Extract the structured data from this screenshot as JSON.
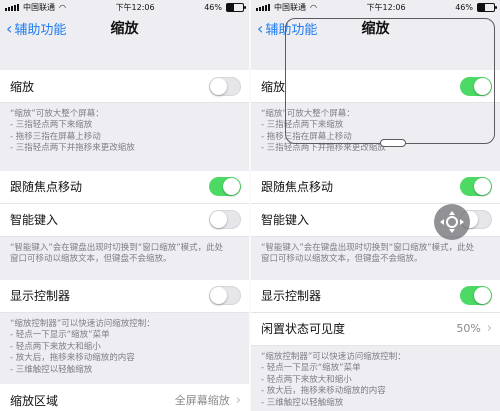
{
  "left": {
    "status": {
      "carrier": "中国联通",
      "time": "下午12:06",
      "battery": "46%",
      "battery_level": 0.46
    },
    "nav": {
      "back": "辅助功能",
      "title": "缩放"
    },
    "zoom_row": {
      "label": "缩放",
      "on": false
    },
    "zoom_note": [
      "“缩放”可放大整个屏幕：",
      "- 三指轻点两下来缩放",
      "- 拖移三指在屏幕上移动",
      "- 三指轻点两下并拖移来更改缩放"
    ],
    "follow_row": {
      "label": "跟随焦点移动",
      "on": true
    },
    "keyboard_row": {
      "label": "智能键入",
      "on": false
    },
    "keyboard_note": [
      "“智能键入”会在键盘出现时切换到“窗口缩放”模式，此处",
      "窗口可移动以缩放文本，但键盘不会缩放。"
    ],
    "controller_row": {
      "label": "显示控制器",
      "on": false
    },
    "controller_note": [
      "“缩放控制器”可以快速访问缩放控制：",
      "- 轻点一下显示“缩放”菜单",
      "- 轻点两下来放大和缩小",
      "- 放大后，拖移来移动缩放的内容",
      "- 三维触控以轻触缩放"
    ],
    "region_row": {
      "label": "缩放区域",
      "value": "全屏幕缩放"
    }
  },
  "right": {
    "status": {
      "carrier": "中国联通",
      "time": "下午12:06",
      "battery": "46%",
      "battery_level": 0.46
    },
    "nav": {
      "back": "辅助功能",
      "title": "缩放"
    },
    "zoom_row": {
      "label": "缩放",
      "on": true
    },
    "zoom_note": [
      "“缩放”可放大整个屏幕：",
      "- 三指轻点两下来缩放",
      "- 拖移三指在屏幕上移动",
      "- 三指轻点两下并拖移来更改缩放"
    ],
    "follow_row": {
      "label": "跟随焦点移动",
      "on": true
    },
    "keyboard_row": {
      "label": "智能键入",
      "on": false
    },
    "keyboard_note": [
      "“智能键入”会在键盘出现时切换到“窗口缩放”模式，此处",
      "窗口可移动以缩放文本，但键盘不会缩放。"
    ],
    "controller_row": {
      "label": "显示控制器",
      "on": true
    },
    "idle_row": {
      "label": "闲置状态可见度",
      "value": "50%"
    },
    "controller_note": [
      "“缩放控制器”可以快速访问缩放控制：",
      "- 轻点一下显示“缩放”菜单",
      "- 轻点两下来放大和缩小",
      "- 放大后，拖移来移动缩放的内容",
      "- 三维触控以轻触缩放"
    ]
  },
  "colors": {
    "accent": "#1e7cf2",
    "toggle_on": "#4cd964"
  }
}
